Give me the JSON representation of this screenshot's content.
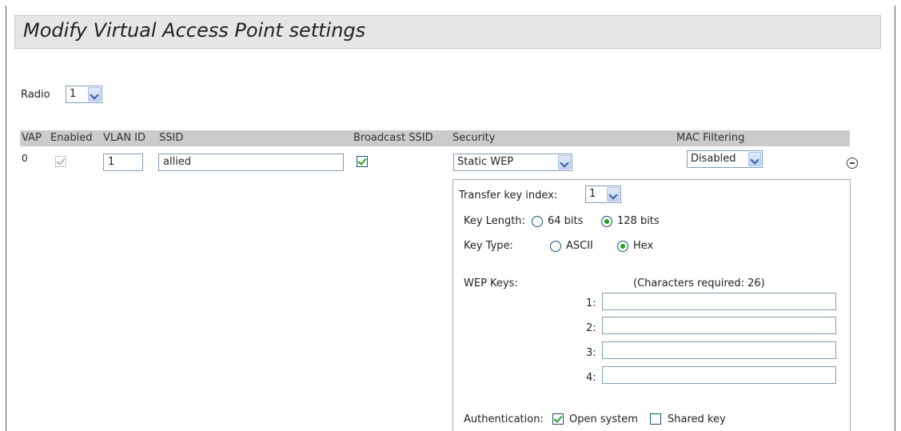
{
  "page_title": "Modify Virtual Access Point settings",
  "radio": {
    "label": "Radio",
    "value": "1"
  },
  "table": {
    "headers": {
      "vap": "VAP",
      "enabled": "Enabled",
      "vlan_id": "VLAN ID",
      "ssid": "SSID",
      "broadcast_ssid": "Broadcast SSID",
      "security": "Security",
      "mac_filtering": "MAC Filtering"
    },
    "row": {
      "vap": "0",
      "enabled": true,
      "vlan_id": "1",
      "ssid": "allied",
      "broadcast_ssid": true,
      "security": "Static WEP",
      "mac_filtering": "Disabled"
    }
  },
  "wep": {
    "transfer_key_index_label": "Transfer key index:",
    "transfer_key_index": "1",
    "key_length_label": "Key Length:",
    "key_length_options": [
      "64 bits",
      "128 bits"
    ],
    "key_length_selected": "128 bits",
    "key_type_label": "Key Type:",
    "key_type_options": [
      "ASCII",
      "Hex"
    ],
    "key_type_selected": "Hex",
    "wep_keys_label": "WEP Keys:",
    "chars_required": "(Characters required: 26)",
    "keys": [
      {
        "label": "1:",
        "value": ""
      },
      {
        "label": "2:",
        "value": ""
      },
      {
        "label": "3:",
        "value": ""
      },
      {
        "label": "4:",
        "value": ""
      }
    ],
    "authentication_label": "Authentication:",
    "auth_open_label": "Open system",
    "auth_open_checked": true,
    "auth_shared_label": "Shared key",
    "auth_shared_checked": false
  }
}
